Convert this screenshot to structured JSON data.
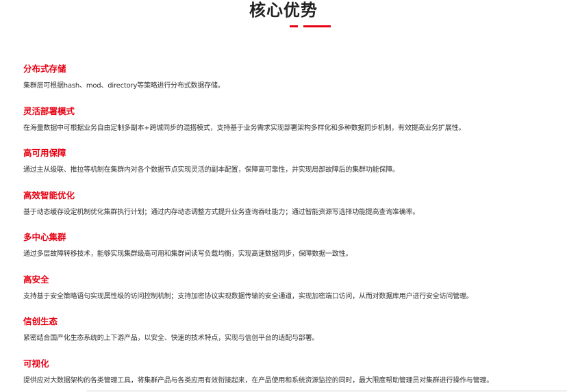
{
  "title": "核心优势",
  "colors": {
    "accent": "#e60012",
    "text": "#333333",
    "title": "#222222"
  },
  "items": [
    {
      "title": "分布式存储",
      "desc": "集群层可根据hash、mod、directory等策略进行分布式数据存储。"
    },
    {
      "title": "灵活部署模式",
      "desc": "在海量数据中可根据业务自由定制多副本+跨城同步的混搭模式，支持基于业务需求实现部署架构多样化和多种数据同步机制，有效提高业务扩展性。"
    },
    {
      "title": "高可用保障",
      "desc": "通过主从级联、推拉等机制在集群内对各个数据节点实现灵活的副本配置，保障高可靠性，并实现局部故障后的集群功能保障。"
    },
    {
      "title": "高效智能优化",
      "desc": "基于动态缓存设定机制优化集群执行计划；通过内存动态调整方式提升业务查询吞吐能力；通过智能资源写选择功能提高查询准确率。"
    },
    {
      "title": "多中心集群",
      "desc": "通过多层故障转移技术，能够实现集群级高可用和集群间读写负载均衡，实现高速数据同步，保障数据一致性。"
    },
    {
      "title": "高安全",
      "desc": "支持基于安全策略语句实现属性级的访问控制机制；支持加密协议实现数据传输的安全通道，实现加密端口访问，从而对数据库用户进行安全访问管理。"
    },
    {
      "title": "信创生态",
      "desc": "紧密结合国产化生态系统的上下游产品，以安全、快速的技术特点，实现与信创平台的适配与部署。"
    },
    {
      "title": "可视化",
      "desc": "提供应对大数据架构的各类管理工具，将集群产品与各类应用有效衔接起来，在产品使用和系统资源监控的同时，最大限度帮助管理员对集群进行操作与管理。"
    }
  ]
}
